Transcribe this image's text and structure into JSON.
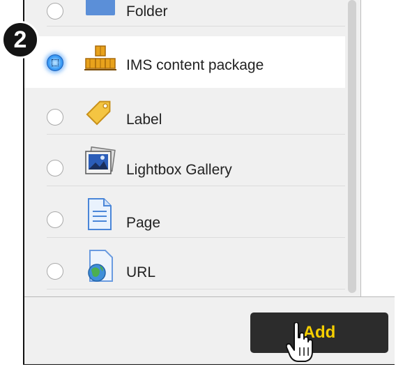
{
  "step_number": "2",
  "activities": [
    {
      "label": "Folder",
      "selected": false,
      "icon": "folder-icon"
    },
    {
      "label": "IMS content package",
      "selected": true,
      "icon": "package-boxes-icon"
    },
    {
      "label": "Label",
      "selected": false,
      "icon": "tag-icon"
    },
    {
      "label": "Lightbox Gallery",
      "selected": false,
      "icon": "photo-gallery-icon"
    },
    {
      "label": "Page",
      "selected": false,
      "icon": "page-document-icon"
    },
    {
      "label": "URL",
      "selected": false,
      "icon": "url-globe-icon"
    }
  ],
  "footer": {
    "add_label": "Add"
  },
  "colors": {
    "selected_radio": "#3b9cf5",
    "add_text": "#f6cf00",
    "add_bg": "#2c2c2c"
  }
}
